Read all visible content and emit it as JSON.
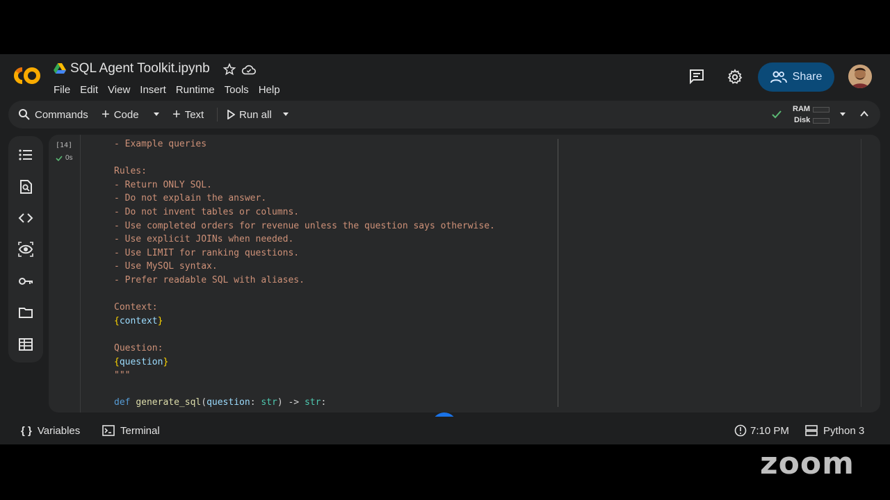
{
  "app": {
    "title": "SQL Agent Toolkit.ipynb",
    "menu": [
      "File",
      "Edit",
      "View",
      "Insert",
      "Runtime",
      "Tools",
      "Help"
    ],
    "share_label": "Share"
  },
  "toolbar": {
    "commands_label": "Commands",
    "code_label": "Code",
    "text_label": "Text",
    "run_all_label": "Run all",
    "ram_label": "RAM",
    "disk_label": "Disk"
  },
  "sidebar": {
    "icons": [
      "toc-icon",
      "find-icon",
      "code-snippets-icon",
      "variables-inspector-icon",
      "secrets-key-icon",
      "files-folder-icon",
      "data-table-icon"
    ]
  },
  "cell": {
    "exec_count": "[14]",
    "exec_time": "0s",
    "lines": [
      "- Example queries",
      "",
      "Rules:",
      "- Return ONLY SQL.",
      "- Do not explain the answer.",
      "- Do not invent tables or columns.",
      "- Use completed orders for revenue unless the question says otherwise.",
      "- Use explicit JOINs when needed.",
      "- Use LIMIT for ranking questions.",
      "- Use MySQL syntax.",
      "- Prefer readable SQL with aliases.",
      "",
      "Context:",
      "{context}",
      "",
      "Question:",
      "{question}",
      "\"\"\"",
      "",
      "def generate_sql(question: str) -> str:"
    ]
  },
  "status": {
    "variables_label": "Variables",
    "terminal_label": "Terminal",
    "time": "7:10 PM",
    "kernel": "Python 3"
  },
  "overlay": {
    "zoom_watermark": "zoom"
  },
  "colors": {
    "share_bg": "#0b4a78",
    "string": "#ce9178",
    "keyword": "#569cd6",
    "gemini": "#1a73e8"
  }
}
